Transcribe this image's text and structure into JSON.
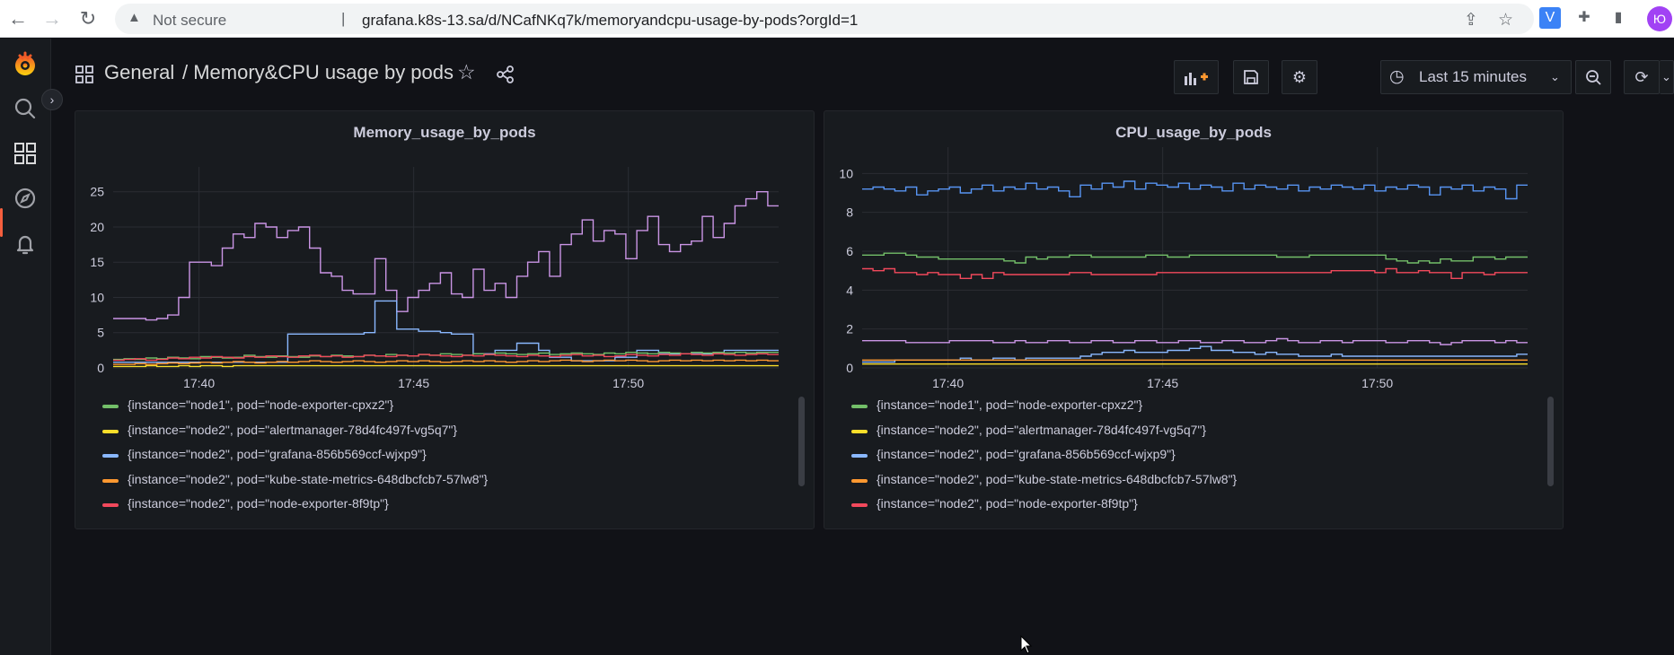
{
  "browser": {
    "security_label": "Not secure",
    "url": "grafana.k8s-13.sa/d/NCafNKq7k/memoryandcpu-usage-by-pods?orgId=1",
    "profile_initial": "Ю",
    "extension_label": "V"
  },
  "header": {
    "folder": "General",
    "separator_title": "/ Memory&CPU usage by pods",
    "time_range": "Last 15 minutes"
  },
  "series_colors": {
    "node-exporter-cpxz2": "#73bf69",
    "alertmanager": "#fade2a",
    "grafana": "#8ab8ff",
    "kube-state-metrics": "#ff9830",
    "node-exporter-8f9tp": "#f2495c",
    "purple": "#ca95e5",
    "blue2": "#5794f2"
  },
  "legend": [
    {
      "label": "{instance=\"node1\", pod=\"node-exporter-cpxz2\"}",
      "color": "#73bf69"
    },
    {
      "label": "{instance=\"node2\", pod=\"alertmanager-78d4fc497f-vg5q7\"}",
      "color": "#fade2a"
    },
    {
      "label": "{instance=\"node2\", pod=\"grafana-856b569ccf-wjxp9\"}",
      "color": "#8ab8ff"
    },
    {
      "label": "{instance=\"node2\", pod=\"kube-state-metrics-648dbcfcb7-57lw8\"}",
      "color": "#ff9830"
    },
    {
      "label": "{instance=\"node2\", pod=\"node-exporter-8f9tp\"}",
      "color": "#f2495c"
    }
  ],
  "chart_data": [
    {
      "type": "line",
      "title": "Memory_usage_by_pods",
      "x_ticks": [
        "17:40",
        "17:45",
        "17:50"
      ],
      "y_ticks": [
        "0",
        "5",
        "10",
        "15",
        "20",
        "25"
      ],
      "ylim": [
        0,
        27
      ],
      "xlim": [
        0,
        15.5
      ],
      "grid": true,
      "series": [
        {
          "color": "#ca95e5",
          "values": [
            7,
            7,
            7,
            6.8,
            7,
            7.5,
            10,
            15,
            15,
            14.5,
            17,
            19,
            18.5,
            20.5,
            20,
            18.5,
            19.5,
            20,
            17,
            13.5,
            13,
            11,
            10.5,
            10.5,
            15.5,
            11,
            8,
            10,
            11,
            12,
            13.5,
            10.5,
            10,
            14,
            11,
            12,
            10,
            13,
            15,
            16.5,
            13,
            17.5,
            19,
            21,
            18,
            19.5,
            19,
            15.5,
            19.5,
            21.5,
            17.5,
            16.5,
            17.5,
            18,
            21.5,
            18.5,
            20.5,
            23,
            24,
            25,
            23
          ]
        },
        {
          "color": "#8ab8ff",
          "values": [
            0.8,
            0.8,
            0.8,
            0.8,
            0.8,
            0.8,
            0.8,
            0.8,
            0.8,
            0.8,
            0.8,
            0.8,
            0.8,
            0.8,
            0.8,
            0.8,
            4.8,
            4.8,
            4.8,
            4.8,
            4.8,
            4.8,
            4.8,
            5,
            9.5,
            9.5,
            5.5,
            5.5,
            5.2,
            5.2,
            5,
            4.8,
            4.8,
            2,
            2,
            2.5,
            2.5,
            3.5,
            3.5,
            2.5,
            1.5,
            1.5,
            1,
            1,
            1,
            1,
            1.5,
            1.5,
            2.5,
            2.5,
            2,
            2,
            2,
            2,
            2,
            2,
            2.5,
            2.5,
            2.5,
            2.5,
            2.5
          ]
        },
        {
          "color": "#73bf69",
          "values": [
            1.2,
            1.3,
            1.2,
            1.4,
            1.3,
            1.5,
            1.4,
            1.3,
            1.6,
            1.5,
            1.4,
            1.5,
            1.8,
            1.6,
            1.5,
            1.7,
            1.6,
            1.5,
            1.7,
            1.6,
            1.8,
            1.7,
            1.6,
            1.8,
            1.7,
            1.9,
            1.8,
            1.7,
            1.9,
            1.8,
            2,
            1.9,
            1.8,
            2,
            1.9,
            2.1,
            2,
            1.9,
            2,
            2.1,
            1.9,
            2,
            2.1,
            2,
            1.9,
            2.1,
            2,
            2.2,
            2.1,
            2,
            2.2,
            2.1,
            2,
            2.2,
            2.1,
            2.2,
            2.1,
            2.2,
            2.1,
            2.2,
            2.2
          ]
        },
        {
          "color": "#f2495c",
          "values": [
            1.1,
            1.2,
            1.3,
            1.1,
            1.2,
            1.4,
            1.3,
            1.5,
            1.4,
            1.6,
            1.5,
            1.4,
            1.6,
            1.5,
            1.7,
            1.6,
            1.5,
            1.7,
            1.8,
            1.6,
            1.7,
            1.5,
            1.6,
            1.8,
            1.7,
            1.6,
            1.8,
            1.7,
            1.9,
            1.8,
            1.7,
            1.6,
            1.8,
            1.7,
            1.9,
            1.8,
            1.7,
            1.6,
            1.8,
            1.7,
            1.6,
            1.8,
            1.9,
            1.7,
            1.8,
            1.6,
            1.7,
            1.9,
            1.8,
            1.7,
            1.9,
            1.8,
            2,
            1.9,
            1.8,
            2,
            1.9,
            1.8,
            1.9,
            2,
            1.9
          ]
        },
        {
          "color": "#ff9830",
          "values": [
            0.5,
            0.5,
            0.6,
            0.5,
            0.6,
            0.7,
            0.6,
            0.7,
            0.8,
            0.7,
            0.8,
            0.9,
            0.8,
            0.7,
            0.8,
            0.9,
            0.8,
            0.9,
            1,
            0.9,
            0.8,
            0.9,
            1,
            0.9,
            0.8,
            0.9,
            1,
            0.9,
            1,
            0.9,
            0.8,
            0.9,
            1,
            0.9,
            1,
            0.9,
            0.8,
            0.9,
            1,
            0.9,
            1,
            1.1,
            1,
            0.9,
            1,
            1.1,
            1,
            1.1,
            1,
            0.9,
            1,
            1.1,
            1,
            1.1,
            1,
            1.1,
            1,
            1.1,
            1,
            1.1,
            1
          ]
        },
        {
          "color": "#fade2a",
          "values": [
            0.2,
            0.2,
            0.2,
            0.3,
            0.2,
            0.2,
            0.3,
            0.2,
            0.3,
            0.3,
            0.2,
            0.3,
            0.3,
            0.3,
            0.3,
            0.3,
            0.3,
            0.3,
            0.3,
            0.3,
            0.3,
            0.3,
            0.3,
            0.3,
            0.3,
            0.3,
            0.3,
            0.3,
            0.3,
            0.3,
            0.3,
            0.3,
            0.3,
            0.3,
            0.3,
            0.3,
            0.3,
            0.3,
            0.3,
            0.3,
            0.3,
            0.3,
            0.3,
            0.3,
            0.3,
            0.3,
            0.3,
            0.3,
            0.3,
            0.3,
            0.3,
            0.3,
            0.3,
            0.3,
            0.3,
            0.3,
            0.3,
            0.3,
            0.3,
            0.3,
            0.3
          ]
        }
      ]
    },
    {
      "type": "line",
      "title": "CPU_usage_by_pods",
      "x_ticks": [
        "17:40",
        "17:45",
        "17:50"
      ],
      "y_ticks": [
        "0",
        "2",
        "4",
        "6",
        "8",
        "10"
      ],
      "ylim": [
        0,
        10.8
      ],
      "xlim": [
        0,
        15.5
      ],
      "grid": true,
      "series": [
        {
          "color": "#5794f2",
          "values": [
            9.2,
            9.3,
            9.2,
            9.1,
            9.3,
            8.9,
            9.1,
            9.2,
            9.3,
            9.0,
            9.2,
            9.4,
            9.1,
            9.3,
            9.2,
            9.5,
            9.2,
            9.3,
            9.1,
            8.8,
            9.4,
            9.2,
            9.5,
            9.3,
            9.6,
            9.2,
            9.5,
            9.4,
            9.3,
            9.5,
            9.2,
            9.4,
            9.3,
            9.1,
            9.5,
            9.2,
            9.4,
            9.3,
            9.2,
            9.4,
            9.1,
            9.3,
            9.2,
            9.4,
            9.3,
            9.2,
            9.4,
            9.1,
            9.3,
            9.2,
            9.4,
            9.3,
            8.9,
            9.3,
            9.2,
            9.4,
            9.1,
            9.3,
            9.2,
            8.7,
            9.4
          ]
        },
        {
          "color": "#73bf69",
          "values": [
            5.8,
            5.8,
            5.9,
            5.9,
            5.8,
            5.7,
            5.7,
            5.6,
            5.6,
            5.6,
            5.6,
            5.6,
            5.6,
            5.5,
            5.4,
            5.7,
            5.6,
            5.7,
            5.7,
            5.8,
            5.8,
            5.7,
            5.7,
            5.7,
            5.7,
            5.7,
            5.8,
            5.8,
            5.7,
            5.7,
            5.8,
            5.8,
            5.8,
            5.8,
            5.8,
            5.8,
            5.8,
            5.8,
            5.7,
            5.7,
            5.7,
            5.8,
            5.8,
            5.8,
            5.8,
            5.8,
            5.8,
            5.8,
            5.6,
            5.5,
            5.4,
            5.5,
            5.4,
            5.6,
            5.5,
            5.5,
            5.7,
            5.7,
            5.6,
            5.7,
            5.7
          ]
        },
        {
          "color": "#f2495c",
          "values": [
            5.1,
            5.0,
            5.1,
            4.9,
            4.9,
            4.8,
            4.9,
            4.8,
            4.8,
            4.6,
            4.8,
            4.6,
            4.9,
            4.8,
            4.8,
            4.8,
            4.8,
            4.8,
            4.8,
            4.9,
            4.9,
            4.8,
            4.8,
            4.8,
            4.8,
            4.8,
            4.8,
            4.9,
            4.9,
            4.9,
            4.9,
            4.9,
            4.9,
            4.9,
            4.9,
            4.9,
            4.9,
            4.9,
            4.9,
            4.9,
            4.9,
            4.9,
            4.9,
            5.0,
            5.0,
            5.0,
            5.0,
            4.9,
            5.1,
            4.9,
            4.9,
            5.0,
            4.9,
            4.9,
            4.6,
            4.9,
            4.9,
            4.8,
            4.9,
            4.9,
            4.9
          ]
        },
        {
          "color": "#ca95e5",
          "values": [
            1.4,
            1.4,
            1.4,
            1.4,
            1.3,
            1.3,
            1.3,
            1.3,
            1.4,
            1.4,
            1.4,
            1.4,
            1.3,
            1.3,
            1.4,
            1.3,
            1.3,
            1.4,
            1.4,
            1.3,
            1.3,
            1.4,
            1.4,
            1.3,
            1.3,
            1.4,
            1.4,
            1.3,
            1.3,
            1.4,
            1.4,
            1.3,
            1.3,
            1.4,
            1.4,
            1.3,
            1.3,
            1.4,
            1.5,
            1.4,
            1.3,
            1.3,
            1.4,
            1.4,
            1.3,
            1.4,
            1.4,
            1.4,
            1.3,
            1.3,
            1.4,
            1.4,
            1.3,
            1.2,
            1.3,
            1.4,
            1.4,
            1.4,
            1.3,
            1.4,
            1.3
          ]
        },
        {
          "color": "#8ab8ff",
          "values": [
            0.3,
            0.3,
            0.3,
            0.4,
            0.4,
            0.4,
            0.4,
            0.4,
            0.4,
            0.5,
            0.4,
            0.4,
            0.5,
            0.5,
            0.4,
            0.5,
            0.5,
            0.5,
            0.5,
            0.5,
            0.6,
            0.7,
            0.8,
            0.8,
            0.9,
            0.8,
            0.8,
            0.8,
            0.9,
            0.9,
            1.0,
            1.1,
            0.9,
            0.9,
            0.8,
            0.8,
            0.7,
            0.8,
            0.7,
            0.7,
            0.6,
            0.6,
            0.6,
            0.7,
            0.6,
            0.6,
            0.6,
            0.6,
            0.6,
            0.6,
            0.6,
            0.6,
            0.6,
            0.6,
            0.6,
            0.6,
            0.6,
            0.6,
            0.6,
            0.6,
            0.7
          ]
        },
        {
          "color": "#ff9830",
          "values": [
            0.4,
            0.4,
            0.4,
            0.4,
            0.4,
            0.4,
            0.4,
            0.4,
            0.4,
            0.4,
            0.4,
            0.4,
            0.4,
            0.4,
            0.4,
            0.4,
            0.4,
            0.4,
            0.4,
            0.4,
            0.4,
            0.4,
            0.4,
            0.4,
            0.4,
            0.4,
            0.4,
            0.4,
            0.4,
            0.4,
            0.4,
            0.4,
            0.4,
            0.4,
            0.4,
            0.4,
            0.4,
            0.4,
            0.4,
            0.4,
            0.4,
            0.4,
            0.4,
            0.4,
            0.4,
            0.4,
            0.4,
            0.4,
            0.4,
            0.4,
            0.4,
            0.4,
            0.4,
            0.4,
            0.4,
            0.4,
            0.4,
            0.4,
            0.4,
            0.4,
            0.4
          ]
        },
        {
          "color": "#fade2a",
          "values": [
            0.2,
            0.2,
            0.2,
            0.2,
            0.2,
            0.2,
            0.2,
            0.2,
            0.2,
            0.2,
            0.2,
            0.2,
            0.2,
            0.2,
            0.2,
            0.2,
            0.2,
            0.2,
            0.2,
            0.2,
            0.2,
            0.2,
            0.2,
            0.2,
            0.2,
            0.2,
            0.2,
            0.2,
            0.2,
            0.2,
            0.2,
            0.2,
            0.2,
            0.2,
            0.2,
            0.2,
            0.2,
            0.2,
            0.2,
            0.2,
            0.2,
            0.2,
            0.2,
            0.2,
            0.2,
            0.2,
            0.2,
            0.2,
            0.2,
            0.2,
            0.2,
            0.2,
            0.2,
            0.2,
            0.2,
            0.2,
            0.2,
            0.2,
            0.2,
            0.2,
            0.2
          ]
        }
      ]
    }
  ]
}
